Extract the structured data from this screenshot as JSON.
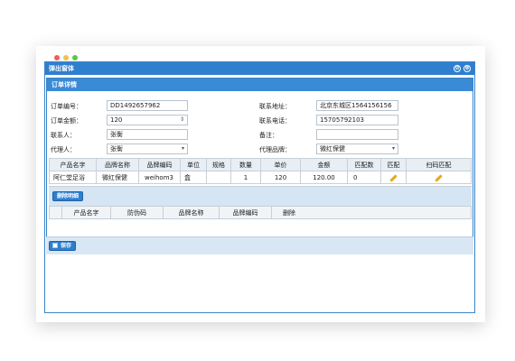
{
  "window": {
    "dots": [
      "#ee5f56",
      "#f5bd4f",
      "#58c64b"
    ],
    "title": "弹出窗体",
    "minimize_icon": "⊘",
    "close_icon": "⊗"
  },
  "panel": {
    "title": "订单详情"
  },
  "form": {
    "order_no_label": "订单编号：",
    "order_no_value": "DD1492657962",
    "amount_label": "订单金额：",
    "amount_value": "120",
    "contact_label": "联系人：",
    "contact_value": "张衡",
    "agent_label": "代理人：",
    "agent_value": "张衡",
    "address_label": "联系地址：",
    "address_value": "北京东城区1564156156",
    "phone_label": "联系电话：",
    "phone_value": "15705792103",
    "remark_label": "备注：",
    "remark_value": "",
    "brand_label": "代理品牌：",
    "brand_value": "微红保健",
    "stepper_icon": "⇕",
    "dropdown_icon": "▾"
  },
  "items_table": {
    "headers": [
      "产品名字",
      "品牌名称",
      "品牌编码",
      "单位",
      "规格",
      "数量",
      "单价",
      "金额",
      "匹配数",
      "匹配",
      "扫码匹配"
    ],
    "row": [
      "阿仁堂足浴",
      "微红保健",
      "weihom3",
      "盒",
      "",
      "1",
      "120",
      "120.00",
      "0"
    ]
  },
  "detail": {
    "delete_button": "删除明细",
    "headers": [
      "",
      "产品名字",
      "防伪码",
      "品牌名称",
      "品牌编码",
      "删除"
    ]
  },
  "save_button": "保存"
}
